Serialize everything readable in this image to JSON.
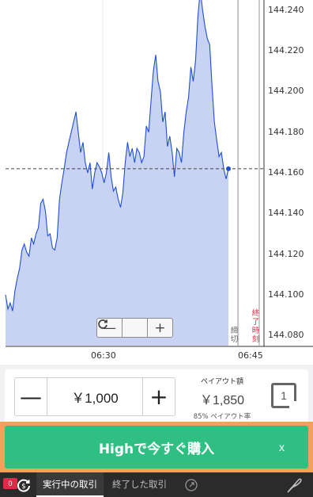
{
  "chart_data": {
    "type": "area",
    "title": "",
    "xlabel": "",
    "ylabel": "",
    "ylim": [
      144.075,
      144.245
    ],
    "y_ticks": [
      "144.240",
      "144.220",
      "144.200",
      "144.180",
      "144.160",
      "144.140",
      "144.120",
      "144.100",
      "144.080"
    ],
    "x_ticks": [
      "06:30",
      "06:45"
    ],
    "current_price": 144.162,
    "cutoff_label": "締切",
    "expiry_label": "終了時刻",
    "line_color": "#1f4fd1",
    "fill_color": "#c8d2f2",
    "series": [
      {
        "values": [
          144.1,
          144.093,
          144.096,
          144.092,
          144.102,
          144.108,
          144.113,
          144.122,
          144.125,
          144.121,
          144.119,
          144.128,
          144.125,
          144.13,
          144.133,
          144.145,
          144.147,
          144.141,
          144.129,
          144.13,
          144.123,
          144.122,
          144.128,
          144.147,
          144.155,
          144.162,
          144.17,
          144.175,
          144.18,
          144.185,
          144.19,
          144.18,
          144.17,
          144.175,
          144.165,
          144.16,
          144.165,
          144.152,
          144.16,
          144.165,
          144.163,
          144.16,
          144.155,
          144.16,
          144.17,
          144.158,
          144.151,
          144.153,
          144.147,
          144.143,
          144.15,
          144.165,
          144.175,
          144.168,
          144.172,
          144.165,
          144.172,
          144.17,
          144.165,
          144.168,
          144.183,
          144.18,
          144.195,
          144.21,
          144.218,
          144.205,
          144.2,
          144.185,
          144.19,
          144.173,
          144.178,
          144.17,
          144.158,
          144.172,
          144.17,
          144.165,
          144.18,
          144.19,
          144.197,
          144.212,
          144.205,
          144.215,
          144.237,
          144.25,
          144.24,
          144.232,
          144.226,
          144.223,
          144.203,
          144.185,
          144.176,
          144.168,
          144.17,
          144.162,
          144.157,
          144.162
        ]
      }
    ]
  },
  "zoom_controls": {
    "zoom_out": "—",
    "reset": "C",
    "zoom_in": "+"
  },
  "panel": {
    "minus": "—",
    "amount": "￥1,000",
    "plus": "+",
    "payout_label": "ペイアウト額",
    "payout_value": "￥1,850",
    "payout_rate": "85% ペイアウト率",
    "expiry_value": "1"
  },
  "buy": {
    "label": "Highで今すぐ購入",
    "close": "x"
  },
  "bottom_bar": {
    "badge": "0",
    "active_tab": "実行中の取引",
    "inactive_tab": "終了した取引"
  }
}
